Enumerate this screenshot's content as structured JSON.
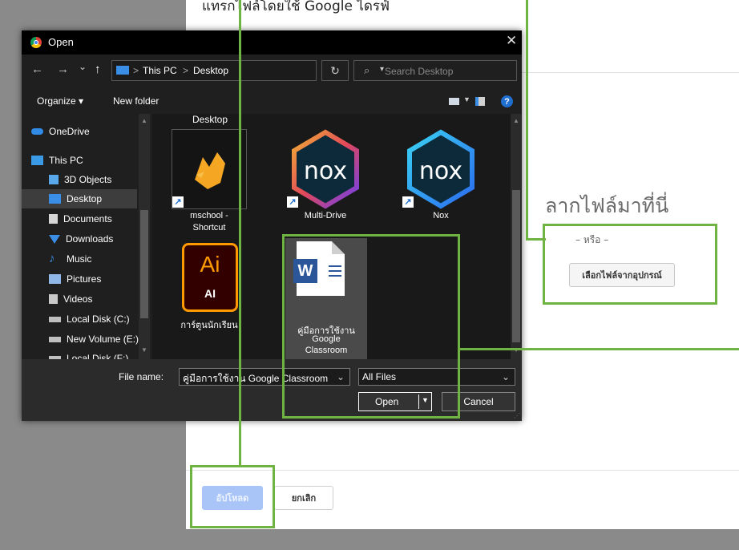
{
  "background": {
    "title": "แทรกไฟล์โดยใช้ Google ไดรฟ์",
    "drag_text": "ลากไฟล์มาที่นี่",
    "or_text": "– หรือ –",
    "select_button": "เลือกไฟล์จากอุปกรณ์",
    "upload_button": "อัปโหลด",
    "cancel_button": "ยกเลิก",
    "upload_state": "disabled"
  },
  "dialog": {
    "title": "Open",
    "close": "✕",
    "nav": {
      "back": "←",
      "forward": "→",
      "recent": "⌄",
      "up": "↑"
    },
    "breadcrumb": [
      "This PC",
      "Desktop"
    ],
    "breadcrumb_sep": ">",
    "refresh": "↻",
    "search_placeholder": "Search Desktop",
    "toolbar": {
      "organize": "Organize ▾",
      "new_folder": "New folder",
      "help": "?"
    },
    "sidebar": [
      {
        "label": "OneDrive",
        "icon": "cloud-icon",
        "color": "#2f8be6"
      },
      {
        "label": "This PC",
        "icon": "computer-icon",
        "color": "#3a9ae6"
      },
      {
        "label": "3D Objects",
        "icon": "cube-icon",
        "color": "#58a7e8"
      },
      {
        "label": "Desktop",
        "icon": "desktop-icon",
        "color": "#3a8ee6",
        "selected": true
      },
      {
        "label": "Documents",
        "icon": "document-icon",
        "color": "#d7d7d7"
      },
      {
        "label": "Downloads",
        "icon": "download-icon",
        "color": "#3a8ee6"
      },
      {
        "label": "Music",
        "icon": "music-icon",
        "color": "#3a8ee6"
      },
      {
        "label": "Pictures",
        "icon": "pictures-icon",
        "color": "#8fb8e8"
      },
      {
        "label": "Videos",
        "icon": "video-icon",
        "color": "#c9c9c9"
      },
      {
        "label": "Local Disk (C:)",
        "icon": "drive-icon",
        "color": "#bfbfbf"
      },
      {
        "label": "New Volume (E:)",
        "icon": "drive-icon",
        "color": "#bfbfbf"
      },
      {
        "label": "Local Disk (F:)",
        "icon": "drive-icon",
        "color": "#bfbfbf"
      }
    ],
    "group_header": "Desktop",
    "files": [
      {
        "name1": "mschool -",
        "name2": "Shortcut",
        "icon": "fox-icon"
      },
      {
        "name1": "Multi-Drive",
        "name2": "",
        "icon": "nox-icon"
      },
      {
        "name1": "Nox",
        "name2": "",
        "icon": "nox-icon"
      },
      {
        "name1": "การ์ตูนนักเรียน",
        "name2": "",
        "icon": "illustrator-icon",
        "icon_text1": "Ai",
        "icon_text2": "AI"
      },
      {
        "name1": "คู่มือการใช้งาน",
        "name2": "Google",
        "name3": "Classroom",
        "icon": "word-icon",
        "icon_text": "W",
        "selected": true
      }
    ],
    "file_name_label": "File name:",
    "file_name_value": "คู่มือการใช้งาน Google Classroom",
    "file_type": "All Files",
    "open_button": "Open",
    "cancel_button": "Cancel"
  },
  "colors": {
    "highlight": "#6fb343",
    "dialog_bg": "#1f1f1f",
    "accent": "#3a8ee6"
  }
}
